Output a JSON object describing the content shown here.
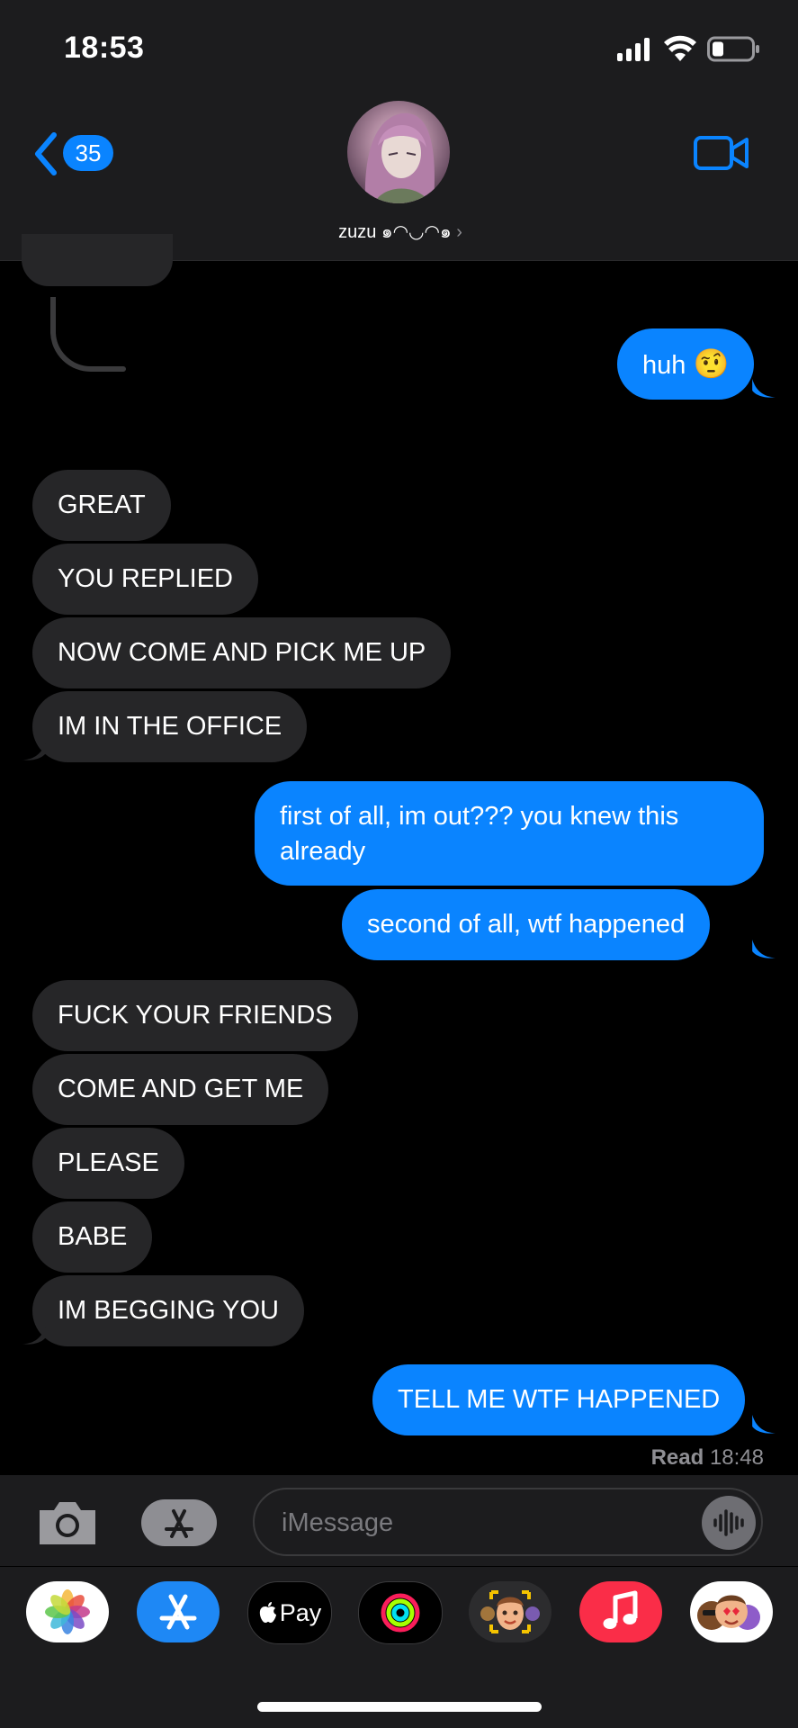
{
  "status_bar": {
    "time": "18:53"
  },
  "header": {
    "back_count": "35",
    "contact_name": "zuzu ๑◠◡◠๑"
  },
  "messages": [
    {
      "from": "them",
      "text": "GREAT"
    },
    {
      "from": "them",
      "text": "YOU REPLIED"
    },
    {
      "from": "them",
      "text": "NOW COME AND PICK ME UP"
    },
    {
      "from": "them",
      "text": "IM IN THE OFFICE"
    },
    {
      "from": "me",
      "text": "first of all, im out??? you knew this already"
    },
    {
      "from": "me",
      "text": "second of all, wtf happened"
    },
    {
      "from": "them",
      "text": "FUCK YOUR FRIENDS"
    },
    {
      "from": "them",
      "text": "COME AND GET ME"
    },
    {
      "from": "them",
      "text": "PLEASE"
    },
    {
      "from": "them",
      "text": "BABE"
    },
    {
      "from": "them",
      "text": "IM BEGGING YOU"
    },
    {
      "from": "me",
      "text": "TELL ME WTF HAPPENED"
    }
  ],
  "huh_message": {
    "text": "huh",
    "emoji": "🤨"
  },
  "read_receipt": {
    "label": "Read",
    "time": "18:48"
  },
  "composer": {
    "placeholder": "iMessage"
  },
  "app_tray": {
    "apple_pay_label": "Pay",
    "apps": [
      "photos-icon",
      "app-store-icon",
      "apple-pay-icon",
      "activity-icon",
      "memoji-icon",
      "music-icon",
      "animoji-stickers-icon"
    ]
  },
  "colors": {
    "accent": "#0a84ff",
    "incoming_bubble": "#262628",
    "bar": "#1c1c1e"
  }
}
